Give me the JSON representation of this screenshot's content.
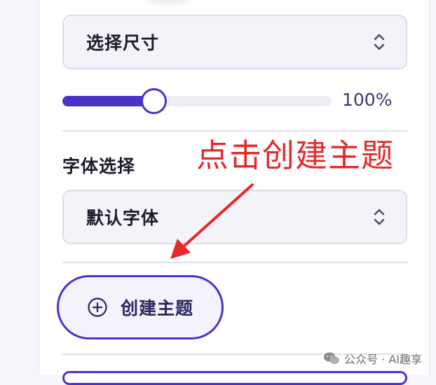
{
  "size_select": {
    "label": "选择尺寸",
    "icon": "chevron-up-down-icon"
  },
  "size_slider": {
    "value_fraction": 0.33,
    "value_label": "100%"
  },
  "font_section": {
    "label": "字体选择"
  },
  "font_select": {
    "label": "默认字体",
    "icon": "chevron-up-down-icon"
  },
  "annotation": {
    "text": "点击创建主题",
    "color": "#e52a2a"
  },
  "create_theme_button": {
    "label": "创建主题",
    "icon": "plus-circle-icon"
  },
  "watermark": {
    "text": "公众号 · AI趣享",
    "icon": "wechat-icon"
  },
  "colors": {
    "accent": "#4a33c8",
    "annotation": "#e52a2a"
  }
}
